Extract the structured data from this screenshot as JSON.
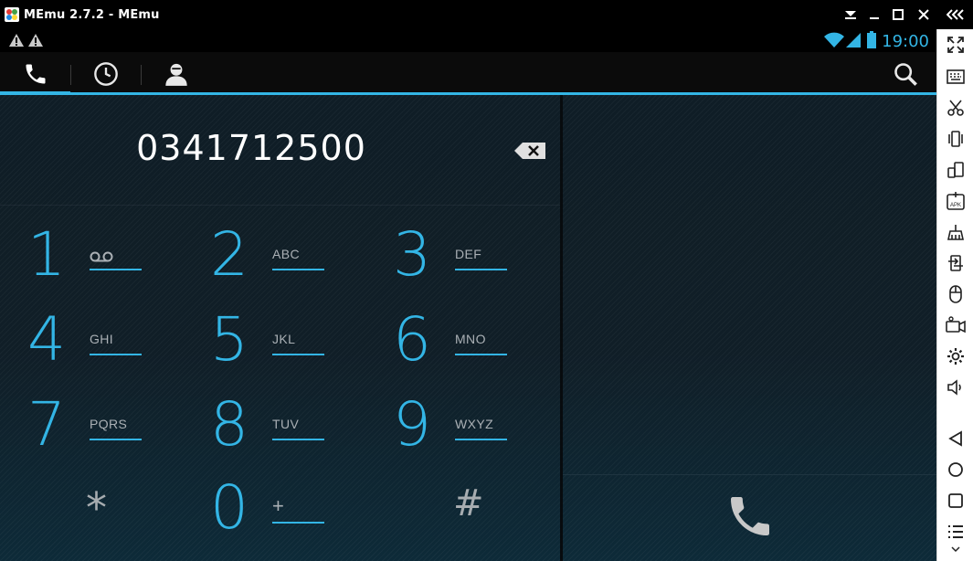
{
  "window": {
    "title": "MEmu 2.7.2 - MEmu"
  },
  "statusbar": {
    "time": "19:00",
    "notifications": [
      "warning-icon",
      "warning-icon"
    ]
  },
  "tabs": [
    {
      "name": "phone",
      "icon": "phone-icon",
      "active": true
    },
    {
      "name": "recent",
      "icon": "clock-icon",
      "active": false
    },
    {
      "name": "contacts",
      "icon": "person-icon",
      "active": false
    }
  ],
  "dialer": {
    "digits": "0341712500",
    "keys": [
      {
        "num": "1",
        "letters": "",
        "extra": "voicemail-icon"
      },
      {
        "num": "2",
        "letters": "ABC"
      },
      {
        "num": "3",
        "letters": "DEF"
      },
      {
        "num": "4",
        "letters": "GHI"
      },
      {
        "num": "5",
        "letters": "JKL"
      },
      {
        "num": "6",
        "letters": "MNO"
      },
      {
        "num": "7",
        "letters": "PQRS"
      },
      {
        "num": "8",
        "letters": "TUV"
      },
      {
        "num": "9",
        "letters": "WXYZ"
      },
      {
        "num": "*",
        "letters": ""
      },
      {
        "num": "0",
        "letters": "+"
      },
      {
        "num": "#",
        "letters": ""
      }
    ]
  },
  "toolbar": {
    "items": [
      "fullscreen-icon",
      "keyboard-icon",
      "screenshot-icon",
      "shake-icon",
      "multi-window-icon",
      "apk-install-icon",
      "clean-icon",
      "transfer-icon",
      "mouse-icon",
      "record-icon",
      "settings-icon",
      "volume-icon",
      "back-icon",
      "home-icon",
      "recent-apps-icon",
      "menu-icon"
    ]
  },
  "colors": {
    "accent": "#33b5e5",
    "statusbar": "#000000",
    "toolbar": "#ffffff"
  }
}
